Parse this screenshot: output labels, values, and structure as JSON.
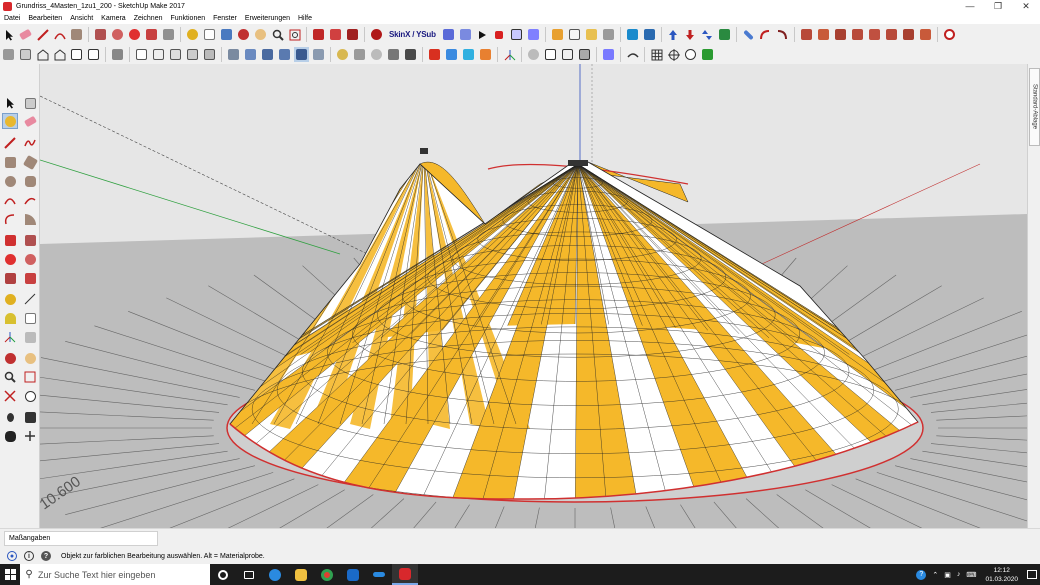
{
  "window": {
    "title": "Grundriss_4Masten_1zu1_200 - SketchUp Make 2017",
    "controls": [
      "minimize",
      "maximize",
      "close"
    ]
  },
  "menu": [
    "Datei",
    "Bearbeiten",
    "Ansicht",
    "Kamera",
    "Zeichnen",
    "Funktionen",
    "Fenster",
    "Erweiterungen",
    "Hilfe"
  ],
  "toolbar": {
    "skinx_label": "SkinX / YSub"
  },
  "viewport": {
    "dimension_text": "10.600",
    "tent_colors": {
      "yellow": "#f5b82a",
      "white": "#ffffff",
      "ground": "#bdbdbd",
      "sky": "#e6e6e6"
    }
  },
  "right_panel": {
    "tray_label": "Standard-Ablage"
  },
  "measure": {
    "label": "Maßangaben"
  },
  "status": {
    "text": "Objekt zur farblichen Bearbeitung auswählen. Alt = Materialprobe."
  },
  "taskbar": {
    "search_placeholder": "Zur Suche Text hier eingeben",
    "time": "12:12",
    "date": "01.03.2020"
  }
}
